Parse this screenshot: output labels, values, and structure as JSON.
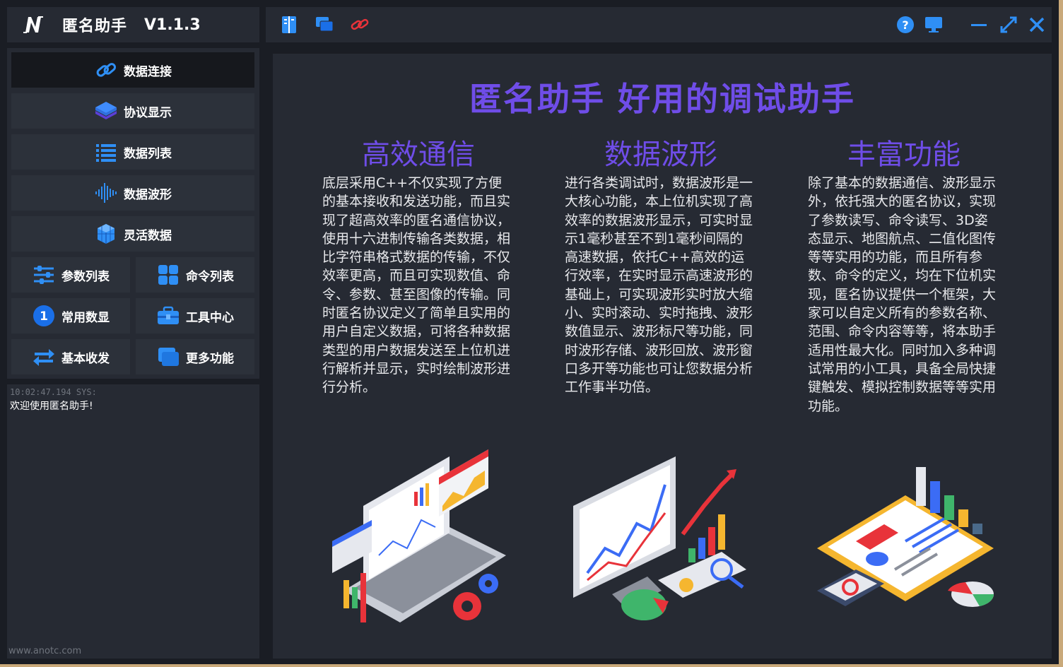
{
  "app": {
    "title": "匿名助手",
    "version": "V1.1.3"
  },
  "nav": {
    "main": [
      {
        "label": "数据连接",
        "icon": "link-icon",
        "active": true
      },
      {
        "label": "协议显示",
        "icon": "layers-icon",
        "active": false
      },
      {
        "label": "数据列表",
        "icon": "list-icon",
        "active": false
      },
      {
        "label": "数据波形",
        "icon": "waveform-icon",
        "active": false
      },
      {
        "label": "灵活数据",
        "icon": "cubes-icon",
        "active": false
      }
    ],
    "grid": [
      {
        "label": "参数列表",
        "icon": "sliders-icon"
      },
      {
        "label": "命令列表",
        "icon": "grid-icon"
      },
      {
        "label": "常用数显",
        "icon": "number-one-icon",
        "badge": "1"
      },
      {
        "label": "工具中心",
        "icon": "toolbox-icon"
      },
      {
        "label": "基本收发",
        "icon": "exchange-icon"
      },
      {
        "label": "更多功能",
        "icon": "windows-icon"
      }
    ]
  },
  "log": {
    "timestamp": "10:02:47.194 SYS:",
    "message": "欢迎使用匿名助手!"
  },
  "footer": {
    "url": "www.anotc.com"
  },
  "toolbar": {
    "left_icons": [
      "book-icon",
      "screens-icon",
      "chain-icon"
    ],
    "right_icons": [
      "help-icon",
      "monitor-icon",
      "minimize-icon",
      "maximize-icon",
      "close-icon"
    ]
  },
  "content": {
    "headline": "匿名助手 好用的调试助手",
    "columns": [
      {
        "title": "高效通信",
        "text": "底层采用C++不仅实现了方便的基本接收和发送功能，而且实现了超高效率的匿名通信协议，使用十六进制传输各类数据，相比字符串格式数据的传输，不仅效率更高，而且可实现数值、命令、参数、甚至图像的传输。同时匿名协议定义了简单且实用的用户自定义数据，可将各种数据类型的用户数据发送至上位机进行解析并显示，实时绘制波形进行分析。"
      },
      {
        "title": "数据波形",
        "text": "进行各类调试时，数据波形是一大核心功能，本上位机实现了高效率的数据波形显示，可实时显示1毫秒甚至不到1毫秒间隔的高速数据，依托C++高效的运行效率，在实时显示高速波形的基础上，可实现波形实时放大缩小、实时滚动、实时拖拽、波形数值显示、波形标尺等功能，同时波形存储、波形回放、波形窗口多开等功能也可让您数据分析工作事半功倍。"
      },
      {
        "title": "丰富功能",
        "text": "除了基本的数据通信、波形显示外，依托强大的匿名协议，实现了参数读写、命令读写、3D姿态显示、地图航点、二值化图传等等实用的功能，而且所有参数、命令的定义，均在下位机实现，匿名协议提供一个框架，大家可以自定义所有的参数名称、范围、命令内容等等，将本助手适用性最大化。同时加入多种调试常用的小工具，具备全局快捷键触发、模拟控制数据等等实用功能。"
      }
    ]
  },
  "colors": {
    "accent": "#6f4de8",
    "panel": "#262a33",
    "button": "#2c313a",
    "active": "#16181d",
    "icon_blue": "#2f8ff5"
  }
}
